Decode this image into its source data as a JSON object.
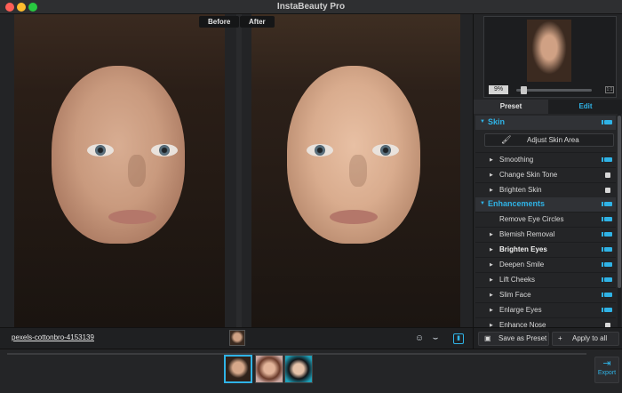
{
  "window": {
    "title": "InstaBeauty Pro"
  },
  "canvas": {
    "before_label": "Before",
    "after_label": "After"
  },
  "filebar": {
    "file_name": "pexels-cottonbro-4153139"
  },
  "preview": {
    "zoom_value": "9%",
    "zoom_fraction": 0.09
  },
  "tabs": {
    "preset": "Preset",
    "edit": "Edit",
    "active": "Edit"
  },
  "sections": {
    "skin": {
      "title": "Skin",
      "toggle": true,
      "skin_area_button": "Adjust Skin Area",
      "items": [
        {
          "label": "Smoothing",
          "toggle": true,
          "bold": false
        },
        {
          "label": "Change Skin Tone",
          "toggle": false,
          "bold": false
        },
        {
          "label": "Brighten Skin",
          "toggle": false,
          "bold": false
        }
      ]
    },
    "enhancements": {
      "title": "Enhancements",
      "toggle": true,
      "items": [
        {
          "label": "Remove Eye Circles",
          "toggle": true,
          "bold": false,
          "arrow": false
        },
        {
          "label": "Blemish Removal",
          "toggle": true,
          "bold": false,
          "arrow": true
        },
        {
          "label": "Brighten Eyes",
          "toggle": true,
          "bold": true,
          "arrow": true
        },
        {
          "label": "Deepen Smile",
          "toggle": true,
          "bold": false,
          "arrow": true
        },
        {
          "label": "Lift Cheeks",
          "toggle": true,
          "bold": false,
          "arrow": true
        },
        {
          "label": "Slim Face",
          "toggle": true,
          "bold": false,
          "arrow": true
        },
        {
          "label": "Enlarge Eyes",
          "toggle": true,
          "bold": false,
          "arrow": true
        },
        {
          "label": "Enhance Nose",
          "toggle": false,
          "bold": false,
          "arrow": true
        }
      ]
    }
  },
  "actions": {
    "save_preset": "Save as Preset",
    "apply_all": "Apply to all"
  },
  "export": {
    "label": "Export"
  },
  "colors": {
    "accent": "#2fb3e6",
    "background": "#1b1c1e",
    "panel": "#242527"
  },
  "icons": {
    "brush": "paintbrush-icon",
    "face_detect": "face-detect-icon",
    "mask": "mask-icon",
    "compare": "split-view-icon",
    "plus": "plus-icon",
    "save": "save-icon",
    "export": "export-icon"
  }
}
